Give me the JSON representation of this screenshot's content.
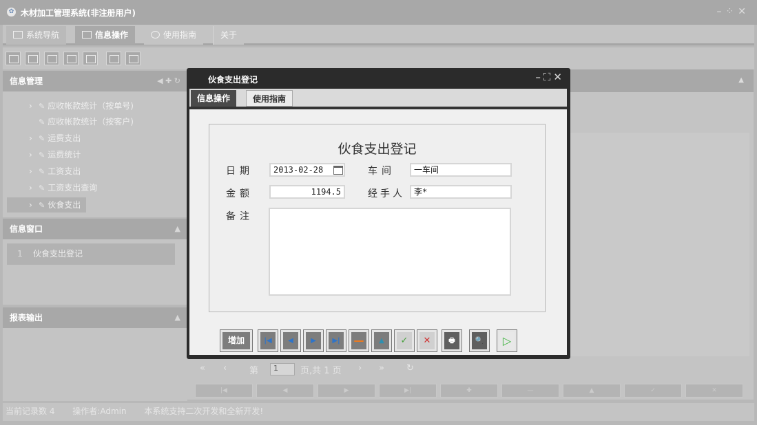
{
  "app": {
    "title": "木材加工管理系统(非注册用户)",
    "logo": "logo-icon"
  },
  "menu": {
    "tabs": [
      {
        "label": "系统导航",
        "icon": "monitor-icon"
      },
      {
        "label": "信息操作",
        "icon": "grid-icon"
      },
      {
        "label": "使用指南",
        "icon": "clock-icon"
      },
      {
        "label": "关于"
      }
    ]
  },
  "left": {
    "info_manage": {
      "title": "信息管理",
      "tools": "◀ ✚ ↻"
    },
    "tree": [
      {
        "label": "应收帐款统计（按单号)"
      },
      {
        "label": "应收帐款统计（按客户)"
      },
      {
        "label": "运费支出"
      },
      {
        "label": "运费统计"
      },
      {
        "label": "工资支出"
      },
      {
        "label": "工资支出查询"
      },
      {
        "label": "伙食支出"
      }
    ],
    "info_window": {
      "title": "信息窗口",
      "items": [
        {
          "index": "1",
          "label": "伙食支出登记"
        }
      ]
    },
    "report": {
      "title": "报表输出"
    }
  },
  "pager": {
    "page_prefix": "第",
    "page": "1",
    "page_suffix": "页,共 1 页"
  },
  "status": {
    "records": "当前记录数 4",
    "operator": "操作者:Admin",
    "note": "本系统支持二次开发和全新开发!"
  },
  "dialog": {
    "title": "伙食支出登记",
    "tabs": [
      "信息操作",
      "使用指南"
    ],
    "form_title": "伙食支出登记",
    "fields": {
      "date": {
        "label": "日期",
        "value": "2013-02-28"
      },
      "workshop": {
        "label": "车间",
        "value": "一车间"
      },
      "amount": {
        "label": "金额",
        "value": "1194.5"
      },
      "handler": {
        "label": "经手人",
        "value": "李*"
      },
      "remark": {
        "label": "备注",
        "value": ""
      }
    },
    "buttons": {
      "add": "增加"
    }
  }
}
